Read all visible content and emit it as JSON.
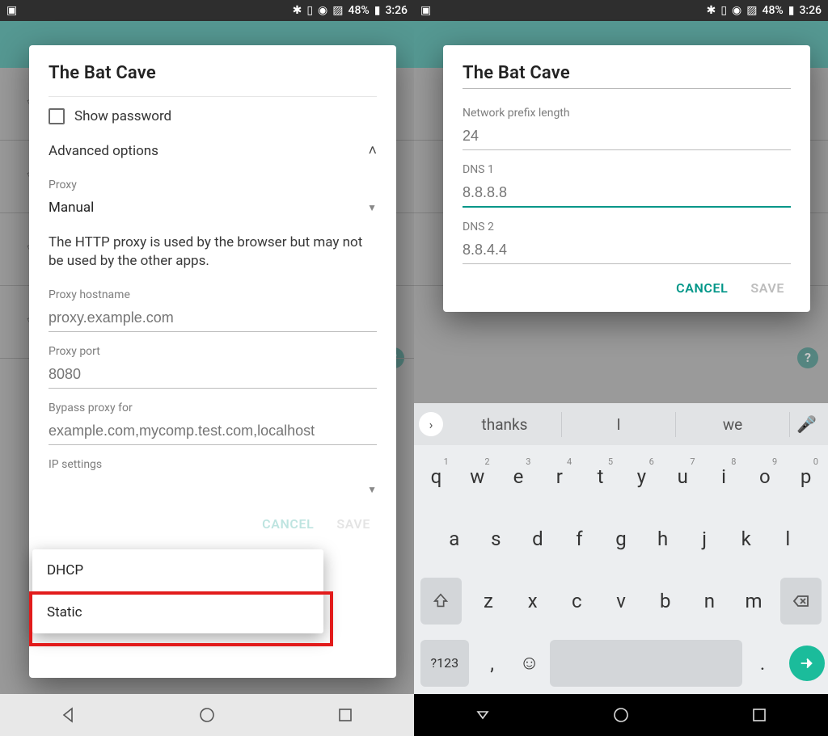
{
  "status": {
    "battery": "48%",
    "time": "3:26"
  },
  "left": {
    "title": "The Bat Cave",
    "show_password": "Show password",
    "advanced": "Advanced options",
    "proxy_label": "Proxy",
    "proxy_value": "Manual",
    "proxy_help": "The HTTP proxy is used by the browser but may not be used by the other apps.",
    "hostname_label": "Proxy hostname",
    "hostname_ph": "proxy.example.com",
    "port_label": "Proxy port",
    "port_ph": "8080",
    "bypass_label": "Bypass proxy for",
    "bypass_ph": "example.com,mycomp.test.com,localhost",
    "ip_label": "IP settings",
    "ip_opt1": "DHCP",
    "ip_opt2": "Static",
    "cancel": "CANCEL",
    "save": "SAVE"
  },
  "right": {
    "title": "The Bat Cave",
    "prefix_label": "Network prefix length",
    "prefix_value": "24",
    "dns1_label": "DNS 1",
    "dns1_ph": "8.8.8.8",
    "dns2_label": "DNS 2",
    "dns2_ph": "8.8.4.4",
    "cancel": "CANCEL",
    "save": "SAVE"
  },
  "kb": {
    "sug1": "thanks",
    "sug2": "I",
    "sug3": "we",
    "row1": [
      "q",
      "w",
      "e",
      "r",
      "t",
      "y",
      "u",
      "i",
      "o",
      "p"
    ],
    "row1n": [
      "1",
      "2",
      "3",
      "4",
      "5",
      "6",
      "7",
      "8",
      "9",
      "0"
    ],
    "row2": [
      "a",
      "s",
      "d",
      "f",
      "g",
      "h",
      "j",
      "k",
      "l"
    ],
    "row3": [
      "z",
      "x",
      "c",
      "v",
      "b",
      "n",
      "m"
    ],
    "sym": "?123",
    "comma": ",",
    "period": "."
  }
}
